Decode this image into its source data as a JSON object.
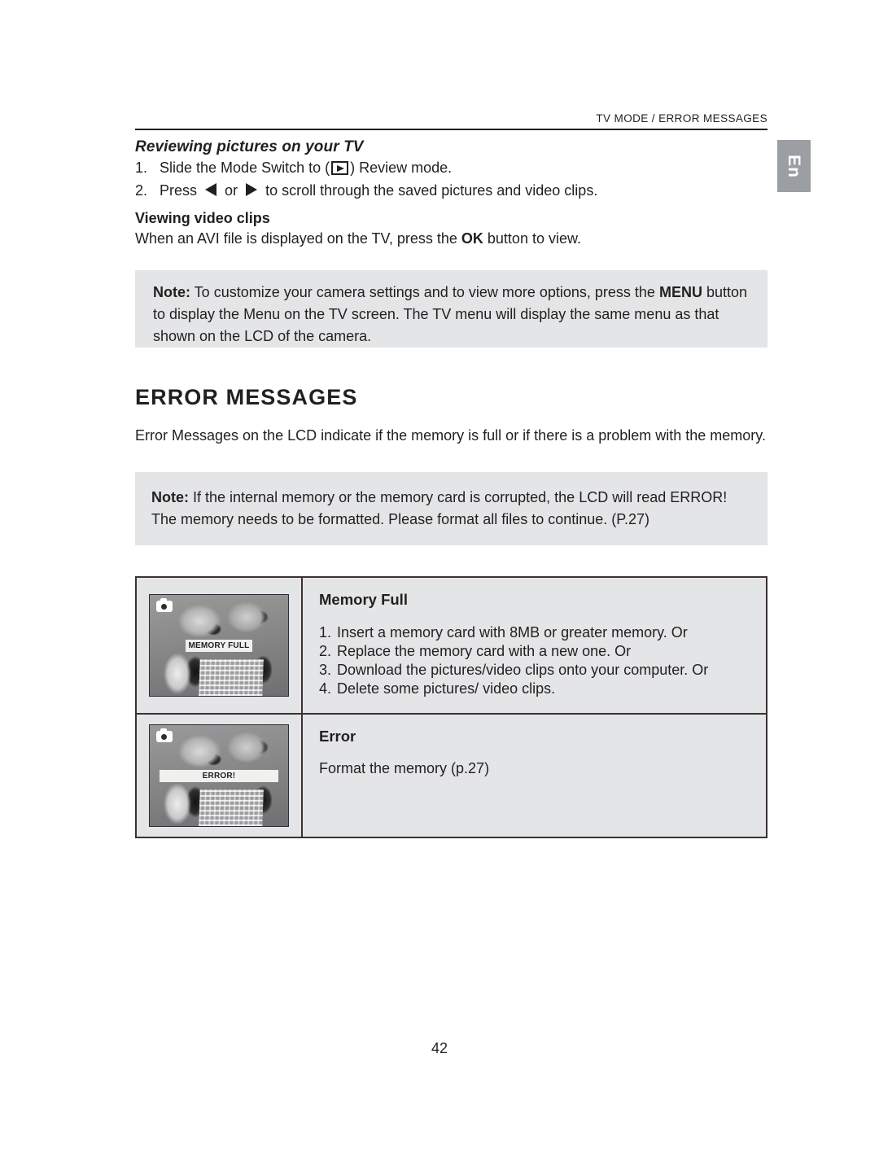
{
  "document": {
    "running_header": "TV MODE / ERROR MESSAGES",
    "language_tab": "En",
    "page_number": "42"
  },
  "tv_section": {
    "heading": "Reviewing pictures on your TV",
    "steps": [
      {
        "num": "1.",
        "text_before": "Slide the Mode Switch to (",
        "icon": "play-review-mode-icon",
        "text_after": ") Review mode."
      },
      {
        "num": "2.",
        "text_before": "Press",
        "icon_left": "left-arrow-icon",
        "conjunction": "or",
        "icon_right": "right-arrow-icon",
        "text_after": "to scroll through the saved pictures and video clips."
      }
    ],
    "video_clips": {
      "heading": "Viewing video clips",
      "text_before": "When an AVI file is displayed on the TV, press the ",
      "emphasis": "OK",
      "text_after": " button to view."
    },
    "note": {
      "label": "Note:",
      "text_1": " To customize your camera settings and to view more options, press the ",
      "emphasis": "MENU",
      "text_2": " button to display the Menu on the TV screen. The TV menu will display the same menu as that shown on the LCD of the camera."
    }
  },
  "error_section": {
    "heading": "ERROR MESSAGES",
    "intro": "Error Messages on the LCD indicate if the memory is full or if there is a problem with the memory.",
    "note": {
      "label": "Note:",
      "text": "  If the internal memory or the memory card is corrupted, the LCD will read ERROR! The memory needs to be formatted. Please format all files to continue.  (P.27)"
    },
    "rows": [
      {
        "image": {
          "icon": "camera-icon",
          "banner": "MEMORY FULL",
          "alt": "lcd-preview-memory-full"
        },
        "title": "Memory Full",
        "items": [
          {
            "num": "1.",
            "text": "Insert a memory card with 8MB or greater memory. Or"
          },
          {
            "num": "2.",
            "text": "Replace the memory card with a new one. Or"
          },
          {
            "num": "3.",
            "text": "Download the pictures/video clips onto your computer. Or"
          },
          {
            "num": "4.",
            "text": "Delete some pictures/ video clips."
          }
        ]
      },
      {
        "image": {
          "icon": "camera-icon",
          "banner": "ERROR!",
          "alt": "lcd-preview-error"
        },
        "title": "Error",
        "plain": "Format the memory (p.27)"
      }
    ]
  },
  "colors": {
    "text": "#231f20",
    "note_background": "#e4e5e6",
    "table_border": "#3b3132",
    "language_tab_background": "#9b9ea3"
  }
}
